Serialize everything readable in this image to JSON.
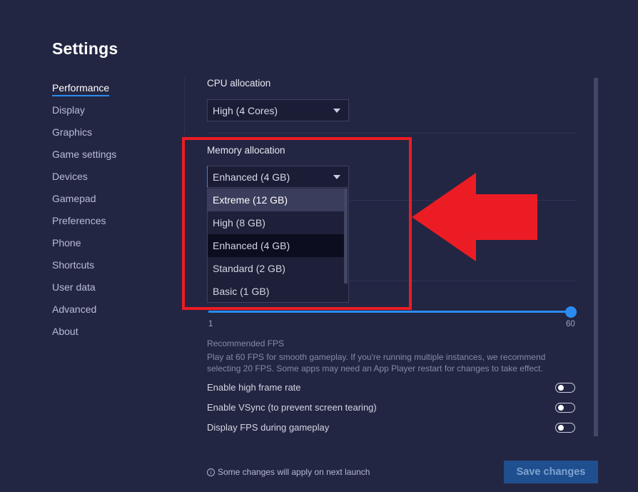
{
  "page": {
    "title": "Settings"
  },
  "sidebar": {
    "items": [
      {
        "label": "Performance",
        "active": true
      },
      {
        "label": "Display"
      },
      {
        "label": "Graphics"
      },
      {
        "label": "Game settings"
      },
      {
        "label": "Devices"
      },
      {
        "label": "Gamepad"
      },
      {
        "label": "Preferences"
      },
      {
        "label": "Phone"
      },
      {
        "label": "Shortcuts"
      },
      {
        "label": "User data"
      },
      {
        "label": "Advanced"
      },
      {
        "label": "About"
      }
    ]
  },
  "cpu": {
    "label": "CPU allocation",
    "value": "High (4 Cores)"
  },
  "memory": {
    "label": "Memory allocation",
    "value": "Enhanced (4 GB)",
    "options": [
      {
        "label": "Extreme (12 GB)",
        "state": "hover"
      },
      {
        "label": "High (8 GB)"
      },
      {
        "label": "Enhanced (4 GB)",
        "state": "selected"
      },
      {
        "label": "Standard (2 GB)"
      },
      {
        "label": "Basic (1 GB)"
      }
    ]
  },
  "fps": {
    "min_label": "1",
    "max_label": "60",
    "value": 60,
    "recommended_title": "Recommended FPS",
    "recommended_desc": "Play at 60 FPS for smooth gameplay. If you're running multiple instances, we recommend selecting 20 FPS. Some apps may need an App Player restart for changes to take effect."
  },
  "toggles": [
    {
      "label": "Enable high frame rate",
      "on": false
    },
    {
      "label": "Enable VSync (to prevent screen tearing)",
      "on": false
    },
    {
      "label": "Display FPS during gameplay",
      "on": false
    }
  ],
  "footer": {
    "note": "Some changes will apply on next launch",
    "info_icon": "info-icon",
    "save_label": "Save changes"
  },
  "annotation": {
    "color": "#ec1c24",
    "arrow_direction": "left"
  },
  "colors": {
    "accent": "#2a8cf0",
    "background": "#232642"
  }
}
